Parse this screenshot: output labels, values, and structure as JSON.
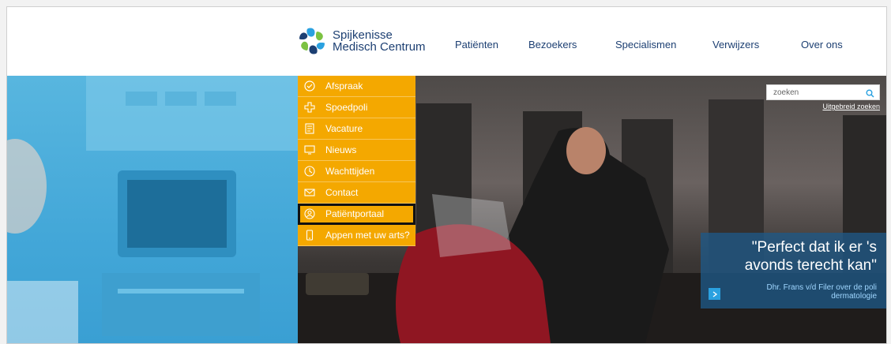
{
  "logo": {
    "line1": "Spijkenisse",
    "line2": "Medisch Centrum"
  },
  "nav": [
    {
      "label": "Patiënten"
    },
    {
      "label": "Bezoekers"
    },
    {
      "label": "Specialismen"
    },
    {
      "label": "Verwijzers"
    },
    {
      "label": "Over ons"
    }
  ],
  "menu": [
    {
      "label": "Afspraak",
      "icon": "check-circle-icon"
    },
    {
      "label": "Spoedpoli",
      "icon": "cross-icon"
    },
    {
      "label": "Vacature",
      "icon": "document-icon"
    },
    {
      "label": "Nieuws",
      "icon": "monitor-icon"
    },
    {
      "label": "Wachttijden",
      "icon": "clock-icon"
    },
    {
      "label": "Contact",
      "icon": "envelope-icon"
    },
    {
      "label": "Patiëntportaal",
      "icon": "portal-icon"
    },
    {
      "label": "Appen met uw arts?",
      "icon": "phone-icon"
    }
  ],
  "search": {
    "placeholder": "zoeken",
    "advanced_label": "Uitgebreid zoeken"
  },
  "quote": {
    "text": "\"Perfect dat ik er 's avonds terecht kan\"",
    "attribution": "Dhr. Frans v/d Filer over de poli dermatologie"
  },
  "colors": {
    "brand_blue": "#1c3f72",
    "menu_orange": "#f4a800",
    "quote_bg": "#1f5887",
    "accent": "#2aa1e0"
  }
}
